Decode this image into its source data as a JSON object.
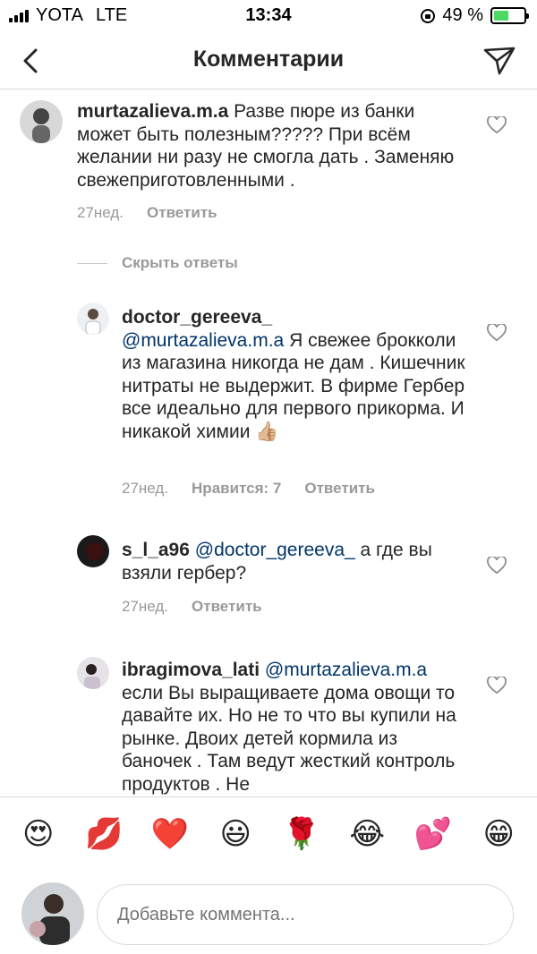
{
  "status": {
    "carrier": "YOTA",
    "network": "LTE",
    "time": "13:34",
    "battery": "49 %",
    "battery_level": 0.49
  },
  "header": {
    "title": "Комментарии",
    "back_icon": "chevron-left-icon",
    "share_icon": "paper-plane-icon"
  },
  "comments": [
    {
      "username": "murtazalieva.m.a",
      "mention": "",
      "text": "Разве пюре из банки может быть полезным????? При всём желании ни разу не смогла дать . Заменяю свежеприготовленными .",
      "time": "27нед.",
      "likes": "",
      "reply": "Ответить"
    },
    {
      "username": "doctor_gereeva_",
      "mention": "@murtazalieva.m.a",
      "text": "Я свежее брокколи из магазина никогда не дам . Кишечник нитраты не выдержит. В фирме Гербер все идеально для первого прикорма. И никакой химии 👍🏼",
      "time": "27нед.",
      "likes": "Нравится: 7",
      "reply": "Ответить"
    },
    {
      "username": "s_l_a96",
      "mention": "@doctor_gereeva_",
      "text": "а где вы взяли гербер?",
      "time": "27нед.",
      "likes": "",
      "reply": "Ответить"
    },
    {
      "username": "ibragimova_lati",
      "mention": "@murtazalieva.m.a",
      "text": "если Вы выращиваете дома овощи то давайте их. Но не то что вы купили на рынке. Двоих детей кормила из баночек . Там ведут жесткий контроль продуктов . Не",
      "time": "",
      "likes": "",
      "reply": ""
    }
  ],
  "hide_replies": "Скрыть ответы",
  "emojis": [
    "😍",
    "💋",
    "❤️",
    "😃",
    "🌹",
    "😂",
    "💕",
    "😁"
  ],
  "input": {
    "placeholder": "Добавьте коммента..."
  }
}
